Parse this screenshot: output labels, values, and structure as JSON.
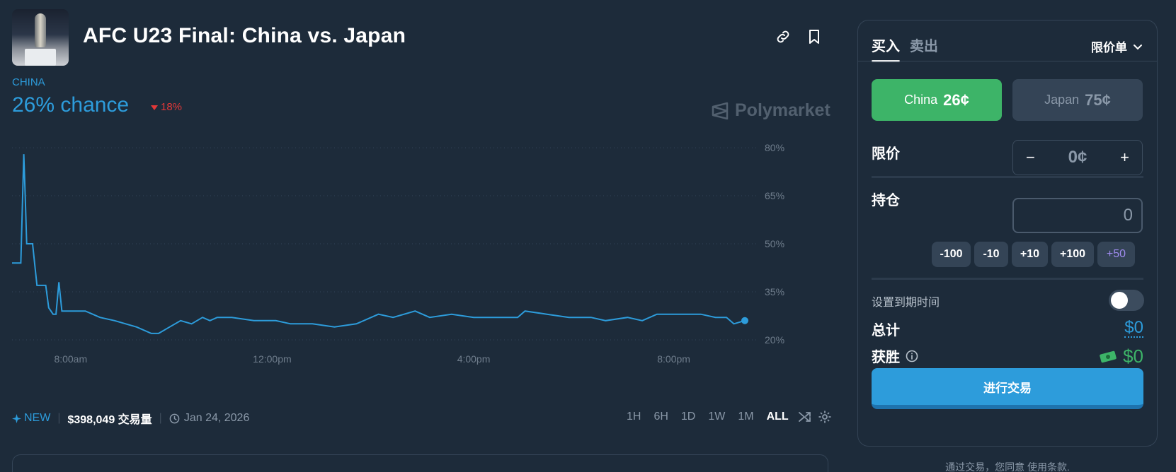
{
  "header": {
    "title": "AFC U23 Final: China vs. Japan"
  },
  "outcome": {
    "label": "CHINA",
    "chance": "26% chance",
    "delta": "18%"
  },
  "brand": "Polymarket",
  "chart_data": {
    "type": "line",
    "title": "",
    "xlabel": "",
    "ylabel": "",
    "x_tick_labels": [
      "8:00am",
      "12:00pm",
      "4:00pm",
      "8:00pm"
    ],
    "y_tick_labels": [
      "80%",
      "65%",
      "50%",
      "35%",
      "20%"
    ],
    "y_ticks": [
      80,
      65,
      50,
      35,
      20
    ],
    "ylim": [
      18,
      82
    ],
    "xlim": [
      0,
      1
    ],
    "grid": true,
    "line_color": "#2d9cdb",
    "series": [
      {
        "x": [
          0,
          0.008,
          0.012,
          0.016,
          0.018,
          0.02,
          0.024,
          0.028,
          0.034,
          0.04,
          0.046,
          0.05,
          0.056,
          0.06,
          0.064,
          0.068,
          0.072,
          0.076,
          0.08,
          0.1,
          0.12,
          0.14,
          0.17,
          0.19,
          0.2,
          0.215,
          0.23,
          0.245,
          0.26,
          0.27,
          0.28,
          0.3,
          0.33,
          0.36,
          0.38,
          0.41,
          0.44,
          0.47,
          0.5,
          0.52,
          0.55,
          0.57,
          0.6,
          0.63,
          0.66,
          0.69,
          0.7,
          0.73,
          0.76,
          0.79,
          0.81,
          0.84,
          0.86,
          0.88,
          0.91,
          0.94,
          0.96,
          0.975,
          0.985,
          1.0
        ],
        "y": [
          44,
          44,
          44,
          78,
          65,
          50,
          50,
          50,
          37,
          37,
          37,
          30,
          28,
          28,
          38,
          29,
          29,
          29,
          29,
          29,
          27,
          26,
          24,
          22,
          22,
          24,
          26,
          25,
          27,
          26,
          27,
          27,
          26,
          26,
          25,
          25,
          24,
          25,
          28,
          27,
          29,
          27,
          28,
          27,
          27,
          27,
          29,
          28,
          27,
          27,
          26,
          27,
          26,
          28,
          28,
          28,
          27,
          27,
          25,
          26
        ]
      }
    ]
  },
  "meta": {
    "new_label": "NEW",
    "volume": "$398,049 交易量",
    "date": "Jan 24, 2026"
  },
  "ranges": [
    "1H",
    "6H",
    "1D",
    "1W",
    "1M",
    "ALL"
  ],
  "panel": {
    "tab_buy": "买入",
    "tab_sell": "卖出",
    "order_type": "限价单",
    "yes_name": "China",
    "yes_price": "26¢",
    "no_name": "Japan",
    "no_price": "75¢",
    "limit_label": "限价",
    "limit_minus": "−",
    "limit_value": "0¢",
    "limit_plus": "+",
    "shares_label": "持仓",
    "shares_value": "0",
    "chips": [
      "-100",
      "-10",
      "+10",
      "+100",
      "+50"
    ],
    "expiry_label": "设置到期时间",
    "total_label": "总计",
    "total_value": "$0",
    "win_label": "获胜",
    "win_value": "$0",
    "trade_button": "进行交易"
  },
  "terms": "通过交易，您同意 使用条款."
}
